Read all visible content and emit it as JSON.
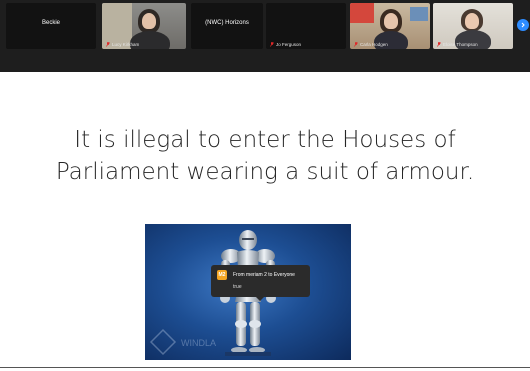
{
  "gallery": {
    "participants": [
      {
        "name": "Beckie",
        "video": false
      },
      {
        "name": "Lucy Kirkham",
        "video": true
      },
      {
        "name": "(NWC) Horizons",
        "video": false
      },
      {
        "name": "Jo Ferguson",
        "video": false
      },
      {
        "name": "Carla Hodgen",
        "video": true
      },
      {
        "name": "Eloise Thompson",
        "video": true
      }
    ],
    "next_icon": "chevron-right-icon"
  },
  "slide": {
    "text": "It is illegal to enter the Houses of Parliament wearing a suit of armour.",
    "image": "suit-of-armour",
    "watermark": "WINDLA"
  },
  "chat_toast": {
    "avatar_initials": "M2",
    "from": "From meriam 2 to Everyone",
    "message": "true"
  },
  "colors": {
    "accent": "#2d8cff",
    "toolbar_bg": "#1e1e1e",
    "avatar_bg": "#f5a623"
  }
}
